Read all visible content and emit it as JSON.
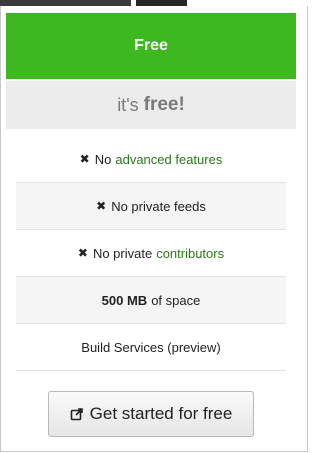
{
  "plan": {
    "name": "Free",
    "price_prefix": "it's",
    "price_value": "free!"
  },
  "features": [
    {
      "icon": "x-icon",
      "prefix": "No",
      "link": "advanced features"
    },
    {
      "icon": "x-icon",
      "prefix": "No private feeds"
    },
    {
      "icon": "x-icon",
      "prefix": "No private",
      "link": "contributors"
    },
    {
      "bold": "500 MB",
      "suffix": "of space"
    },
    {
      "text": "Build Services (preview)"
    }
  ],
  "cta": {
    "label": "Get started for free",
    "icon": "external-link-icon"
  },
  "colors": {
    "header_bg": "#3db81e",
    "price_bg": "#ececec",
    "link": "#2a7a1a"
  }
}
